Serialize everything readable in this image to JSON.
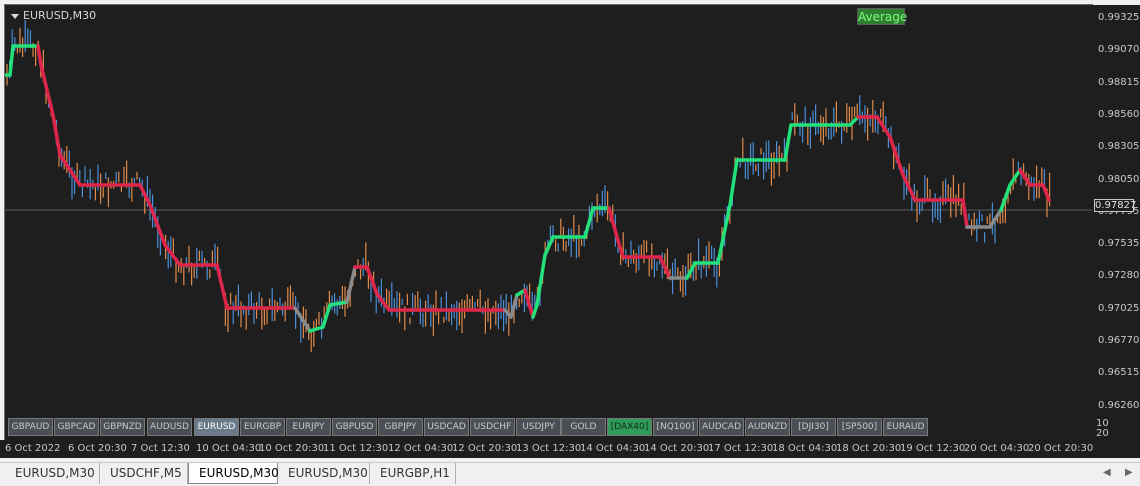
{
  "window": {
    "title": "EURUSD,M30",
    "indicator_button": "Average"
  },
  "price_axis": {
    "labels": [
      "0.99325",
      "0.99070",
      "0.98815",
      "0.98560",
      "0.98305",
      "0.98050",
      "0.97795",
      "0.97535",
      "0.97280",
      "0.97025",
      "0.96770",
      "0.96515",
      "0.96260"
    ],
    "current_price": "0.97827",
    "secondary_labels": [
      "10",
      "20"
    ]
  },
  "time_axis": {
    "labels": [
      "6 Oct 2022",
      "6 Oct 20:30",
      "7 Oct 12:30",
      "10 Oct 04:30",
      "10 Oct 20:30",
      "11 Oct 12:30",
      "12 Oct 04:30",
      "12 Oct 20:30",
      "13 Oct 12:30",
      "14 Oct 04:30",
      "14 Oct 20:30",
      "17 Oct 12:30",
      "18 Oct 04:30",
      "18 Oct 20:30",
      "19 Oct 12:30",
      "20 Oct 04:30",
      "20 Oct 20:30"
    ]
  },
  "symbol_buttons": [
    {
      "label": "GBPAUD",
      "state": "normal"
    },
    {
      "label": "GBPCAD",
      "state": "normal"
    },
    {
      "label": "GBPNZD",
      "state": "normal"
    },
    {
      "label": "AUDUSD",
      "state": "normal"
    },
    {
      "label": "EURUSD",
      "state": "active"
    },
    {
      "label": "EURGBP",
      "state": "normal"
    },
    {
      "label": "EURJPY",
      "state": "normal"
    },
    {
      "label": "GBPUSD",
      "state": "normal"
    },
    {
      "label": "GBPJPY",
      "state": "normal"
    },
    {
      "label": "USDCAD",
      "state": "normal"
    },
    {
      "label": "USDCHF",
      "state": "normal"
    },
    {
      "label": "USDJPY",
      "state": "normal"
    },
    {
      "label": "GOLD",
      "state": "normal"
    },
    {
      "label": "[DAX40]",
      "state": "green"
    },
    {
      "label": "[NQ100]",
      "state": "normal"
    },
    {
      "label": "AUDCAD",
      "state": "normal"
    },
    {
      "label": "AUDNZD",
      "state": "normal"
    },
    {
      "label": "[DJI30]",
      "state": "normal"
    },
    {
      "label": "[SP500]",
      "state": "normal"
    },
    {
      "label": "EURAUD",
      "state": "normal"
    }
  ],
  "tabs": [
    {
      "label": "EURUSD,M30",
      "active": false
    },
    {
      "label": "USDCHF,M5",
      "active": false
    },
    {
      "label": "EURUSD,M30",
      "active": true
    },
    {
      "label": "EURUSD,M30",
      "active": false
    },
    {
      "label": "EURGBP,H1",
      "active": false
    }
  ],
  "colors": {
    "background": "#1e1e1e",
    "bull_bar": "#4a8fd8",
    "bear_bar": "#e08a4a",
    "ma_up": "#22e07a",
    "ma_down": "#e0254a",
    "ma_flat": "#8a8a8a"
  }
}
